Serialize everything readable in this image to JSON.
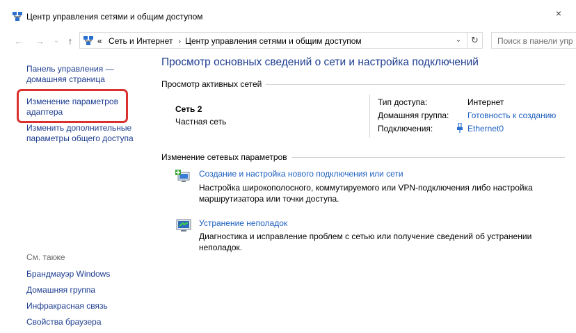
{
  "window": {
    "title": "Центр управления сетями и общим доступом",
    "close_glyph": "×"
  },
  "nav": {
    "back_glyph": "←",
    "forward_glyph": "→",
    "recent_glyph": "⌄",
    "up_glyph": "↑",
    "breadcrumb_overflow": "«",
    "breadcrumbs": [
      "Сеть и Интернет",
      "Центр управления сетями и общим доступом"
    ],
    "crumb_separator": "›",
    "dropdown_glyph": "⌄",
    "refresh_glyph": "↻",
    "search_placeholder": "Поиск в панели упр"
  },
  "sidebar": {
    "home_link": "Панель управления — домашняя страница",
    "adapter_link": "Изменение параметров адаптера",
    "sharing_link": "Изменить дополнительные параметры общего доступа",
    "see_also_label": "См. также",
    "see_also": [
      "Брандмауэр Windows",
      "Домашняя группа",
      "Инфракрасная связь",
      "Свойства браузера"
    ]
  },
  "main": {
    "heading": "Просмотр основных сведений о сети и настройка подключений",
    "active_networks_title": "Просмотр активных сетей",
    "network": {
      "name": "Сеть  2",
      "category": "Частная сеть"
    },
    "properties": [
      {
        "label": "Тип доступа:",
        "value": "Интернет",
        "is_link": false
      },
      {
        "label": "Домашняя группа:",
        "value": "Готовность к созданию",
        "is_link": true
      },
      {
        "label": "Подключения:",
        "value": "Ethernet0",
        "is_link": true
      }
    ],
    "change_settings_title": "Изменение сетевых параметров",
    "tasks": [
      {
        "icon": "new-connection-icon",
        "link": "Создание и настройка нового подключения или сети",
        "description": "Настройка широкополосного, коммутируемого или VPN-подключения либо настройка маршрутизатора или точки доступа."
      },
      {
        "icon": "troubleshoot-icon",
        "link": "Устранение неполадок",
        "description": "Диагностика и исправление проблем с сетью или получение сведений об устранении неполадок."
      }
    ]
  },
  "colors": {
    "link": "#1c5fbf",
    "nav_link": "#1c3c8f",
    "highlight": "#d9322e"
  }
}
